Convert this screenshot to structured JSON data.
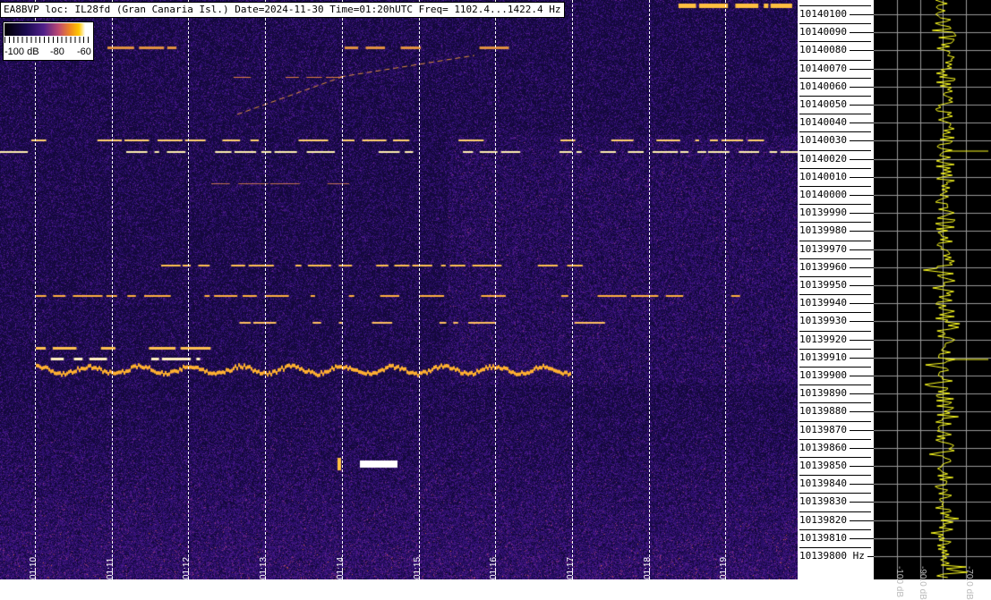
{
  "title": "EA8BVP loc: IL28fd (Gran Canaria Isl.) Date=2024-11-30 Time=01:20hUTC Freq= 1102.4...1422.4 Hz",
  "colorbar": {
    "labels": [
      "-100 dB",
      "-80",
      "-60"
    ]
  },
  "time_labels": [
    "01:10",
    "01:11",
    "01:12",
    "01:13",
    "01:14",
    "01:15",
    "01:16",
    "01:17",
    "01:18",
    "01:19"
  ],
  "freq_labels": [
    "10140100",
    "10140090",
    "10140080",
    "10140070",
    "10140060",
    "10140050",
    "10140040",
    "10140030",
    "10140020",
    "10140010",
    "10140000",
    "10139990",
    "10139980",
    "10139970",
    "10139960",
    "10139950",
    "10139940",
    "10139930",
    "10139920",
    "10139910",
    "10139900",
    "10139890",
    "10139880",
    "10139870",
    "10139860",
    "10139850",
    "10139840",
    "10139830",
    "10139820",
    "10139810",
    "10139800 Hz"
  ],
  "spectrum_labels": [
    "-100 dB",
    "-90.0 dB",
    "-70.0 dB"
  ],
  "colors": {
    "trace": "#ffff20",
    "grid": "#9a9a9a",
    "signal": "#ffc040",
    "background": "#2a1060"
  }
}
